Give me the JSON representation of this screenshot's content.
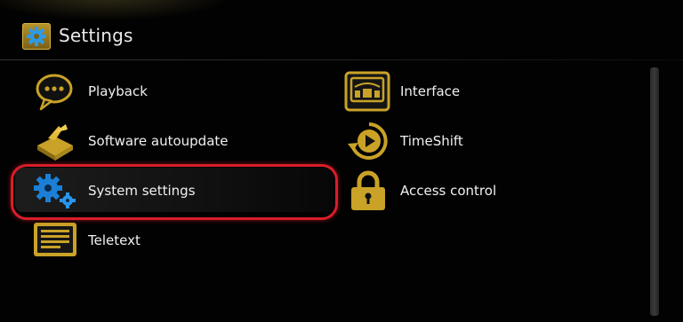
{
  "header": {
    "title": "Settings",
    "icon": "gear-icon"
  },
  "menu": {
    "left": [
      {
        "label": "Playback",
        "icon": "speech-bubble-icon"
      },
      {
        "label": "Software autoupdate",
        "icon": "software-update-icon"
      },
      {
        "label": "System settings",
        "icon": "gears-icon",
        "selected": true
      },
      {
        "label": "Teletext",
        "icon": "teletext-icon"
      }
    ],
    "right": [
      {
        "label": "Interface",
        "icon": "monitor-icon"
      },
      {
        "label": "TimeShift",
        "icon": "timeshift-icon"
      },
      {
        "label": "Access control",
        "icon": "padlock-icon"
      }
    ]
  },
  "colors": {
    "accent_gold": "#c9a227",
    "icon_blue": "#1b7fd6",
    "highlight_red": "#d81e2a",
    "background": "#020202",
    "text": "#f0f0f0"
  }
}
